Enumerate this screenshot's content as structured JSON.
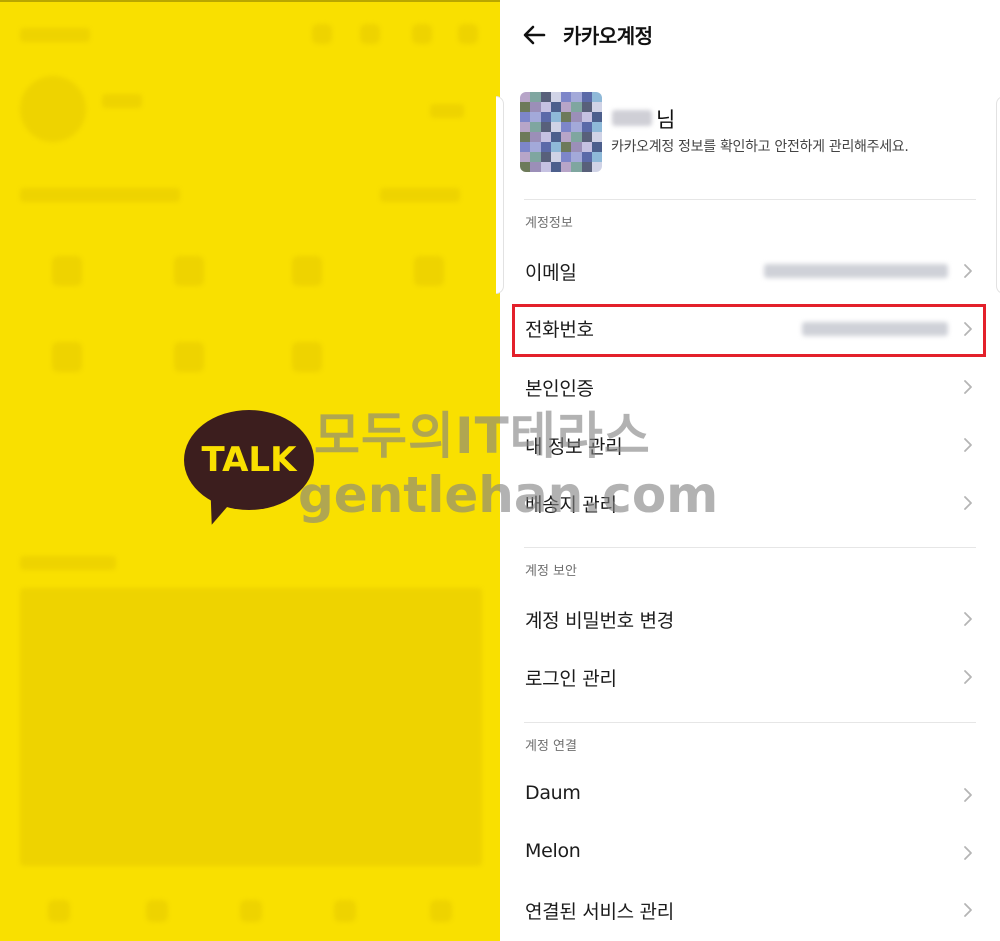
{
  "left": {
    "logo_text": "TALK",
    "background_color": "#f9e000",
    "logo_color": "#3c1e1e"
  },
  "header": {
    "title": "카카오계정",
    "back_icon": "arrow-left-icon"
  },
  "profile": {
    "name_suffix": "님",
    "description": "카카오계정 정보를 확인하고 안전하게 관리해주세요."
  },
  "sections": [
    {
      "title": "계정정보",
      "items": [
        {
          "label": "이메일"
        },
        {
          "label": "전화번호"
        },
        {
          "label": "본인인증"
        },
        {
          "label": "내 정보 관리"
        },
        {
          "label": "배송지 관리"
        }
      ]
    },
    {
      "title": "계정 보안",
      "items": [
        {
          "label": "계정 비밀번호 변경"
        },
        {
          "label": "로그인 관리"
        }
      ]
    },
    {
      "title": "계정 연결",
      "items": [
        {
          "label": "Daum"
        },
        {
          "label": "Melon"
        },
        {
          "label": "연결된 서비스 관리"
        }
      ]
    }
  ],
  "watermark": {
    "line1": "모두의IT테라스",
    "line2": "gentlehan.com"
  },
  "colors": {
    "highlight": "#e3202a",
    "chevron": "#b5b5b5"
  }
}
